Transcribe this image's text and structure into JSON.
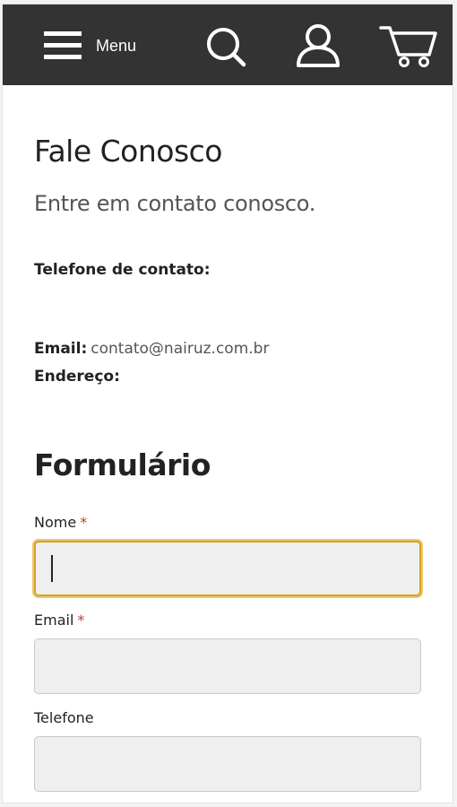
{
  "header": {
    "menu_label": "Menu",
    "icons": [
      "hamburger-icon",
      "search-icon",
      "user-icon",
      "cart-icon"
    ],
    "background": "#333333",
    "icon_color": "#ffffff"
  },
  "page": {
    "title": "Fale Conosco",
    "subtitle": "Entre em contato conosco.",
    "phone_label": "Telefone de contato:",
    "email_label": "Email:",
    "email_value": "contato@nairuz.com.br",
    "address_label": "Endereço:"
  },
  "form": {
    "title": "Formulário",
    "required_marker": "*",
    "fields": [
      {
        "label": "Nome",
        "required": true,
        "value": "",
        "focused": true
      },
      {
        "label": "Email",
        "required": true,
        "value": "",
        "focused": false
      },
      {
        "label": "Telefone",
        "required": false,
        "value": "",
        "focused": false
      }
    ],
    "focus_color": "#d9a21b",
    "required_color": "#c0392b"
  }
}
